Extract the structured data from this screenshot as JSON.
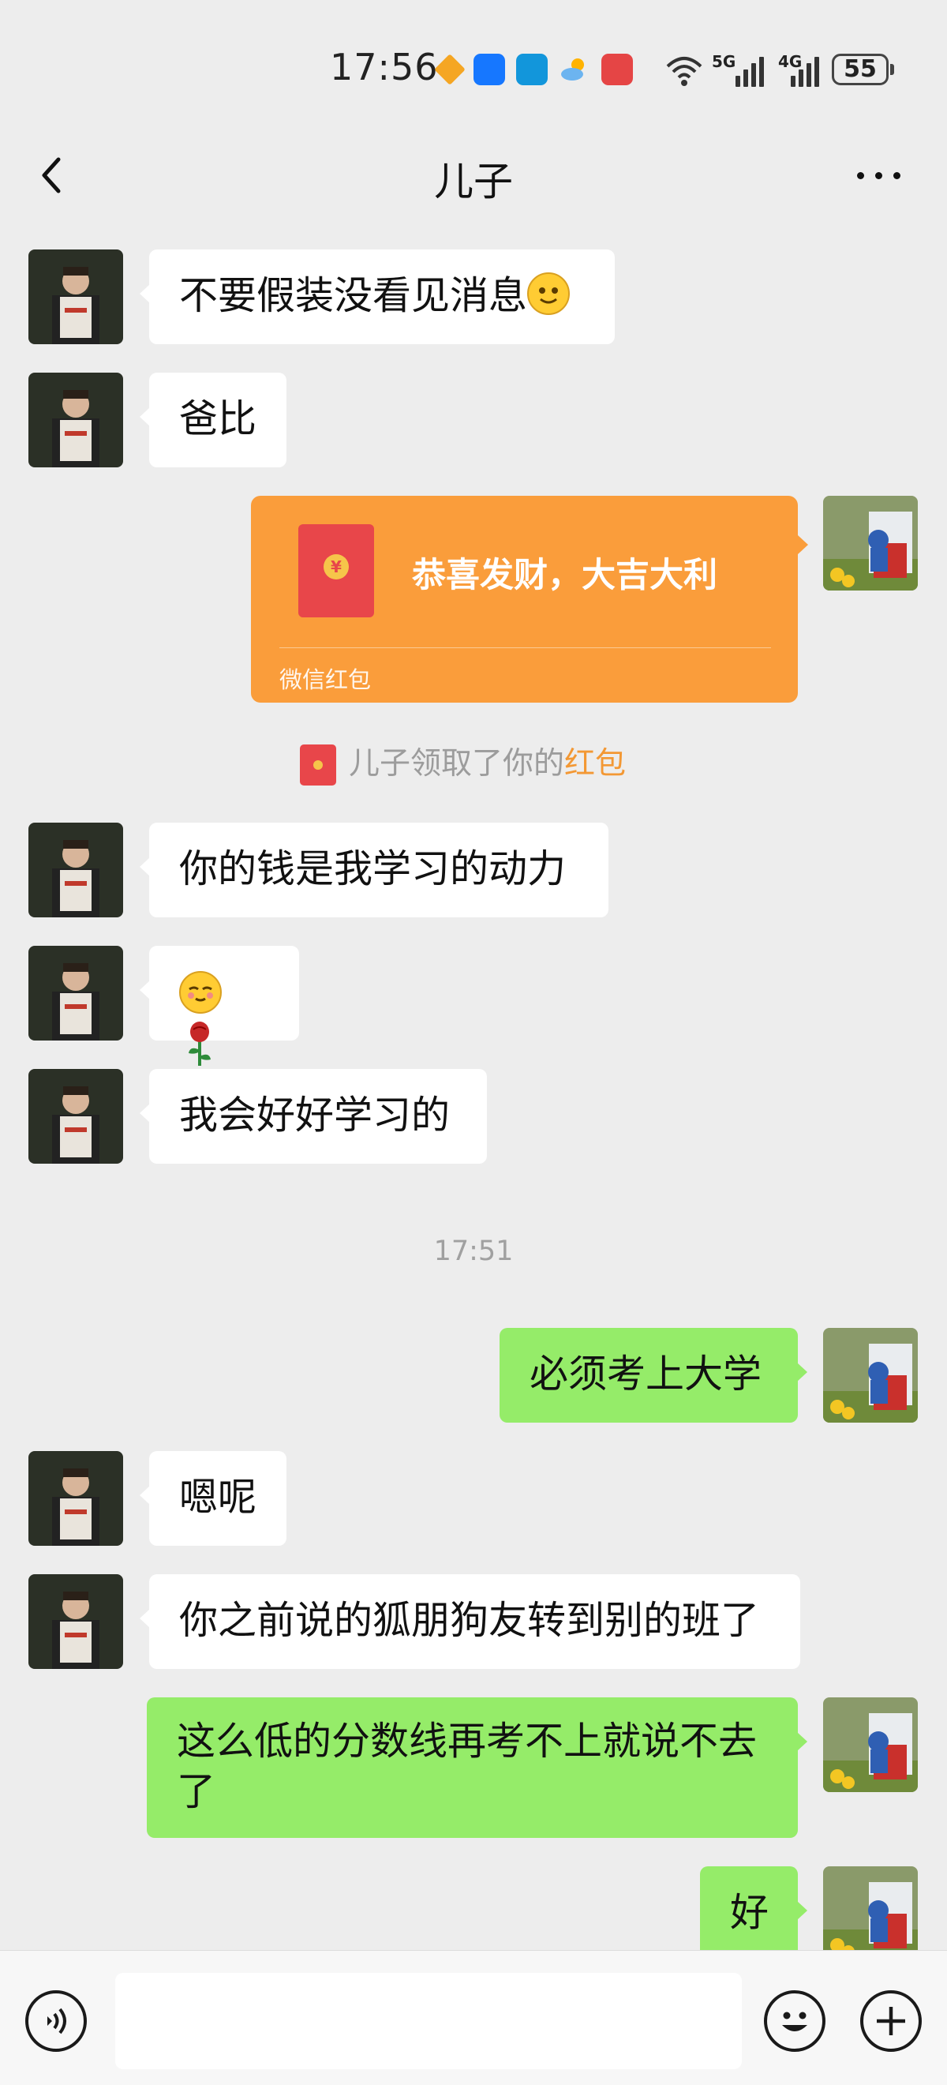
{
  "status_bar": {
    "time": "17:56",
    "network_1": "5G",
    "network_2": "4G",
    "battery": "55"
  },
  "header": {
    "title": "儿子",
    "back_icon": "chevron-left-icon",
    "more_icon": "more-dots-icon"
  },
  "messages": [
    {
      "sender": "son",
      "text": "不要假装没看见消息"
    },
    {
      "sender": "son",
      "text": "爸比"
    },
    {
      "sender": "me",
      "type": "red_packet",
      "title": "恭喜发财，大吉大利",
      "label": "微信红包"
    },
    {
      "sender": "son",
      "text": "你的钱是我学习的动力"
    },
    {
      "sender": "son",
      "text": ""
    },
    {
      "sender": "son",
      "text": "我会好好学习的"
    },
    {
      "sender": "me",
      "text": "必须考上大学"
    },
    {
      "sender": "son",
      "text": "嗯呢"
    },
    {
      "sender": "son",
      "text": "你之前说的狐朋狗友转到别的班了"
    },
    {
      "sender": "me",
      "text": "这么低的分数线再考不上就说不去了"
    },
    {
      "sender": "me",
      "text": "好"
    }
  ],
  "system_notice": {
    "prefix": "儿子领取了你的",
    "link": "红包"
  },
  "time_divider": "17:51",
  "input_bar": {
    "voice_icon": "voice-icon",
    "emoji_icon": "emoji-icon",
    "plus_icon": "plus-icon"
  },
  "colors": {
    "background": "#ededed",
    "my_bubble": "#95ec69",
    "other_bubble": "#ffffff",
    "red_packet": "#fa9d3b",
    "notice_link": "#f39834"
  }
}
